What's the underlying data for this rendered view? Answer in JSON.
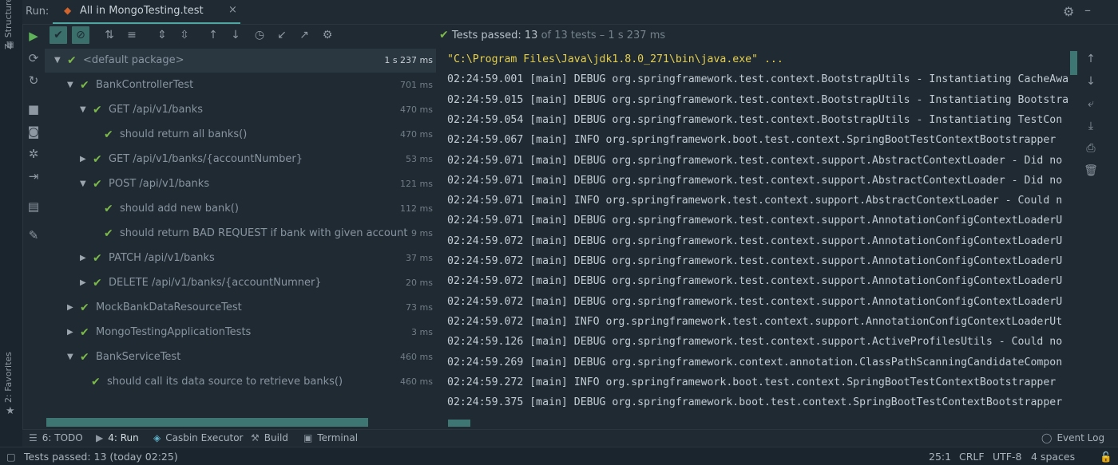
{
  "left_strip": {
    "structure_label": "Z: Structure",
    "favorites_label": "2: Favorites"
  },
  "header": {
    "run_label": "Run:",
    "tab_label": "All in MongoTesting.test",
    "tab_close": "×"
  },
  "toolbar": {
    "buttons": [
      "show-passed",
      "show-ignored",
      "sort-alpha",
      "sort-duration",
      "expand-all",
      "collapse-all",
      "prev-failed",
      "next-failed",
      "history",
      "import",
      "export",
      "settings"
    ]
  },
  "tree": {
    "rows": [
      {
        "name": "<default package>",
        "duration": "1 s 237 ms",
        "expanded": true
      },
      {
        "name": "BankControllerTest",
        "duration": "701 ms",
        "expanded": true
      },
      {
        "name": "GET /api/v1/banks",
        "duration": "470 ms",
        "expanded": true
      },
      {
        "name": "should return all banks()",
        "duration": "470 ms"
      },
      {
        "name": "GET /api/v1/banks/{accountNumber}",
        "duration": "53 ms",
        "expanded": false
      },
      {
        "name": "POST /api/v1/banks",
        "duration": "121 ms",
        "expanded": true
      },
      {
        "name": "should add new bank()",
        "duration": "112 ms"
      },
      {
        "name": "should return BAD REQUEST if bank with given account number",
        "duration": "9 ms"
      },
      {
        "name": "PATCH /api/v1/banks",
        "duration": "37 ms",
        "expanded": false
      },
      {
        "name": "DELETE /api/v1/banks/{accountNumner}",
        "duration": "20 ms",
        "expanded": false
      },
      {
        "name": "MockBankDataResourceTest",
        "duration": "73 ms",
        "expanded": false
      },
      {
        "name": "MongoTestingApplicationTests",
        "duration": "3 ms",
        "expanded": false
      },
      {
        "name": "BankServiceTest",
        "duration": "460 ms",
        "expanded": true
      },
      {
        "name": "should call its data source to retrieve banks()",
        "duration": "460 ms"
      }
    ]
  },
  "summary": {
    "passed_text": "Tests passed: 13",
    "of_text": "of 13 tests – 1 s 237 ms"
  },
  "console": {
    "lines": [
      "\"C:\\Program Files\\Java\\jdk1.8.0_271\\bin\\java.exe\" ...",
      "02:24:59.001 [main] DEBUG org.springframework.test.context.BootstrapUtils - Instantiating CacheAwa",
      "02:24:59.015 [main] DEBUG org.springframework.test.context.BootstrapUtils - Instantiating Bootstra",
      "02:24:59.054 [main] DEBUG org.springframework.test.context.BootstrapUtils - Instantiating TestCon",
      "02:24:59.067 [main] INFO org.springframework.boot.test.context.SpringBootTestContextBootstrapper",
      "02:24:59.071 [main] DEBUG org.springframework.test.context.support.AbstractContextLoader - Did no",
      "02:24:59.071 [main] DEBUG org.springframework.test.context.support.AbstractContextLoader - Did no",
      "02:24:59.071 [main] INFO org.springframework.test.context.support.AbstractContextLoader - Could n",
      "02:24:59.071 [main] DEBUG org.springframework.test.context.support.AnnotationConfigContextLoaderU",
      "02:24:59.072 [main] DEBUG org.springframework.test.context.support.AnnotationConfigContextLoaderU",
      "02:24:59.072 [main] DEBUG org.springframework.test.context.support.AnnotationConfigContextLoaderU",
      "02:24:59.072 [main] DEBUG org.springframework.test.context.support.AnnotationConfigContextLoaderU",
      "02:24:59.072 [main] DEBUG org.springframework.test.context.support.AnnotationConfigContextLoaderU",
      "02:24:59.072 [main] INFO org.springframework.test.context.support.AnnotationConfigContextLoaderUt",
      "02:24:59.126 [main] DEBUG org.springframework.test.context.support.ActiveProfilesUtils - Could no",
      "02:24:59.269 [main] DEBUG org.springframework.context.annotation.ClassPathScanningCandidateCompon",
      "02:24:59.272 [main] INFO org.springframework.boot.test.context.SpringBootTestContextBootstrapper",
      "02:24:59.375 [main] DEBUG org.springframework.boot.test.context.SpringBootTestContextBootstrapper"
    ]
  },
  "bottom_tabs": [
    {
      "icon": "list-icon",
      "label": "6: TODO"
    },
    {
      "icon": "play-icon",
      "label": "4: Run",
      "active": true
    },
    {
      "icon": "casbin-icon",
      "label": "Casbin Executor"
    },
    {
      "icon": "hammer-icon",
      "label": "Build"
    },
    {
      "icon": "terminal-icon",
      "label": "Terminal"
    }
  ],
  "event_log": "Event Log",
  "statusbar": {
    "message": "Tests passed: 13 (today 02:25)",
    "position": "25:1",
    "line_sep": "CRLF",
    "encoding": "UTF-8",
    "indent": "4 spaces"
  },
  "colors": {
    "background": "#1f2a33",
    "accent": "#3d7673",
    "pass": "#7db94a",
    "command": "#e6d04e",
    "run_icon": "#d1652d"
  }
}
